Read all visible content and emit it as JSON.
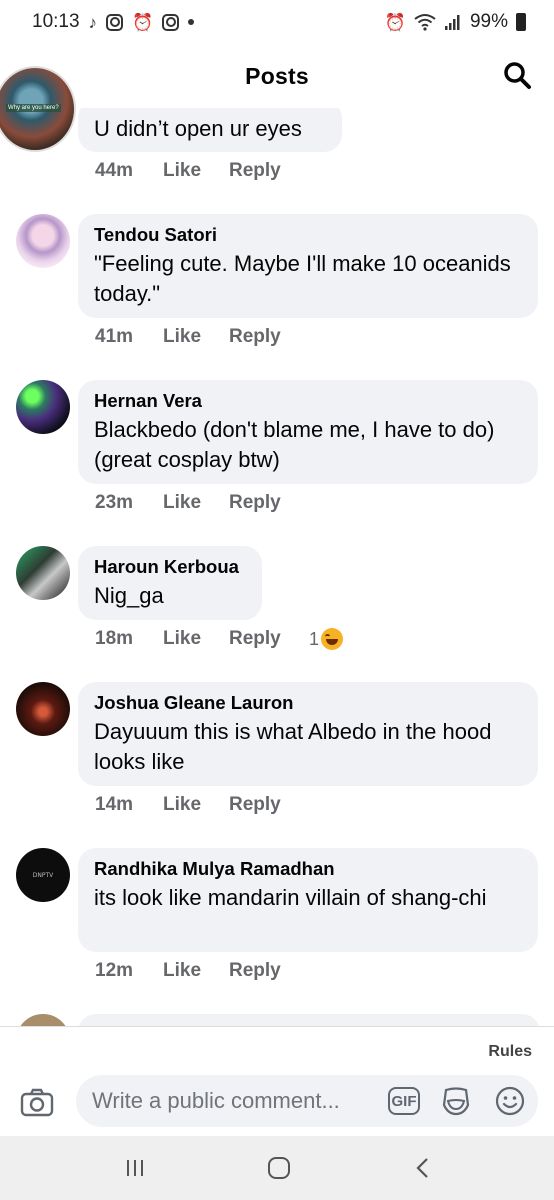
{
  "status_bar": {
    "time": "10:13",
    "battery": "99%"
  },
  "header": {
    "title": "Posts"
  },
  "comments": [
    {
      "author": "",
      "text": "U didn’t open ur eyes",
      "time": "44m",
      "like": "Like",
      "reply": "Reply"
    },
    {
      "author": "Tendou Satori",
      "text": "\"Feeling cute. Maybe I'll make 10 oceanids today.\"",
      "time": "41m",
      "like": "Like",
      "reply": "Reply"
    },
    {
      "author": "Hernan Vera",
      "text": "Blackbedo (don't blame me, I have to do) (great cosplay btw)",
      "time": "23m",
      "like": "Like",
      "reply": "Reply"
    },
    {
      "author": "Haroun Kerboua",
      "text": "Nig_ga",
      "time": "18m",
      "like": "Like",
      "reply": "Reply",
      "reactions": "1"
    },
    {
      "author": "Joshua Gleane Lauron",
      "text": "Dayuuum this is what Albedo in the hood looks like",
      "time": "14m",
      "like": "Like",
      "reply": "Reply"
    },
    {
      "author": "Randhika Mulya Ramadhan",
      "text": "its look like mandarin villain of shang-chi",
      "time": "12m",
      "like": "Like",
      "reply": "Reply"
    }
  ],
  "avatar_texts": {
    "top": "Why are you here?",
    "randhika": "DNPTV"
  },
  "composer": {
    "rules": "Rules",
    "placeholder": "Write a public comment...",
    "gif": "GIF"
  }
}
